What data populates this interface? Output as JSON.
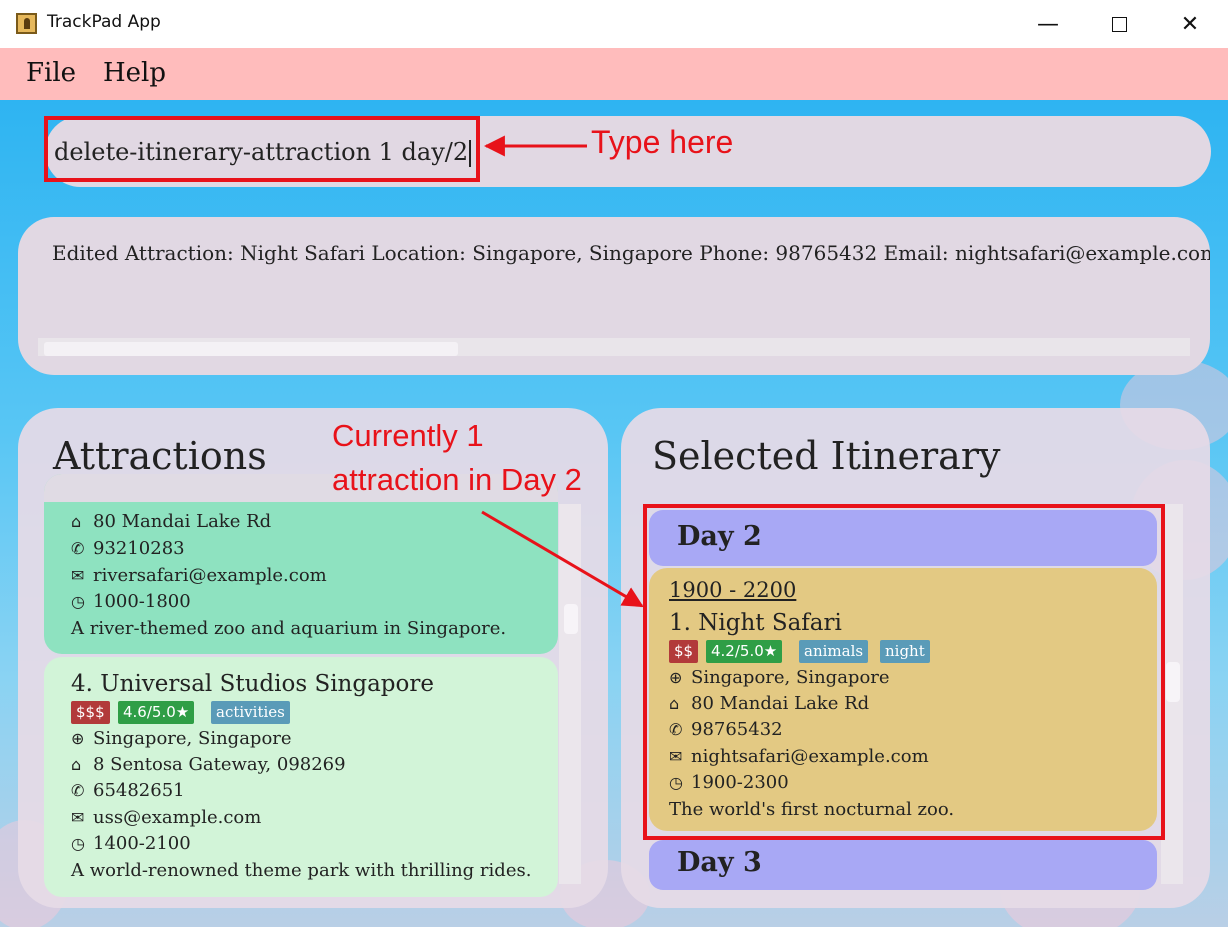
{
  "window": {
    "title": "TrackPad App",
    "minimize": "—",
    "close": "✕"
  },
  "menu": {
    "file": "File",
    "help": "Help"
  },
  "command": {
    "value": "delete-itinerary-attraction 1 day/2"
  },
  "result": {
    "text": "Edited Attraction: Night Safari Location: Singapore, Singapore Phone: 98765432 Email: nightsafari@example.com"
  },
  "attractions": {
    "title": "Attractions",
    "partial_card": {
      "address": "80 Mandai Lake Rd",
      "phone": "93210283",
      "email": "riversafari@example.com",
      "hours": "1000-1800",
      "description": "A river-themed zoo and aquarium in Singapore.",
      "color": "#8ee2c0"
    },
    "card": {
      "name": "4.  Universal Studios Singapore",
      "price": "$$$",
      "rating": "4.6/5.0★",
      "tags": [
        "activities"
      ],
      "location": "Singapore, Singapore",
      "address": "8 Sentosa Gateway, 098269",
      "phone": "65482651",
      "email": "uss@example.com",
      "hours": "1400-2100",
      "description": "A world-renowned theme park with thrilling rides.",
      "color": "#d2f4d8"
    }
  },
  "itinerary": {
    "title": "Selected Itinerary",
    "days": [
      {
        "label": "Day 2",
        "attraction": {
          "time": "1900 - 2200",
          "name": "1.  Night Safari",
          "price": "$$",
          "rating": "4.2/5.0★",
          "tags": [
            "animals",
            "night"
          ],
          "location": "Singapore, Singapore",
          "address": "80 Mandai Lake Rd",
          "phone": "98765432",
          "email": "nightsafari@example.com",
          "hours": "1900-2300",
          "description": "The world's first nocturnal zoo.",
          "color": "#e3c983"
        }
      },
      {
        "label": "Day 3"
      }
    ],
    "day_header_color": "#a8a8f5"
  },
  "icons": {
    "location": "globe-icon",
    "address": "home-icon",
    "phone": "phone-icon",
    "email": "email-icon",
    "hours": "clock-icon"
  },
  "annotations": {
    "type_here": "Type here",
    "currently_line1": "Currently 1",
    "currently_line2": "attraction in Day 2",
    "color": "#e8121a"
  }
}
